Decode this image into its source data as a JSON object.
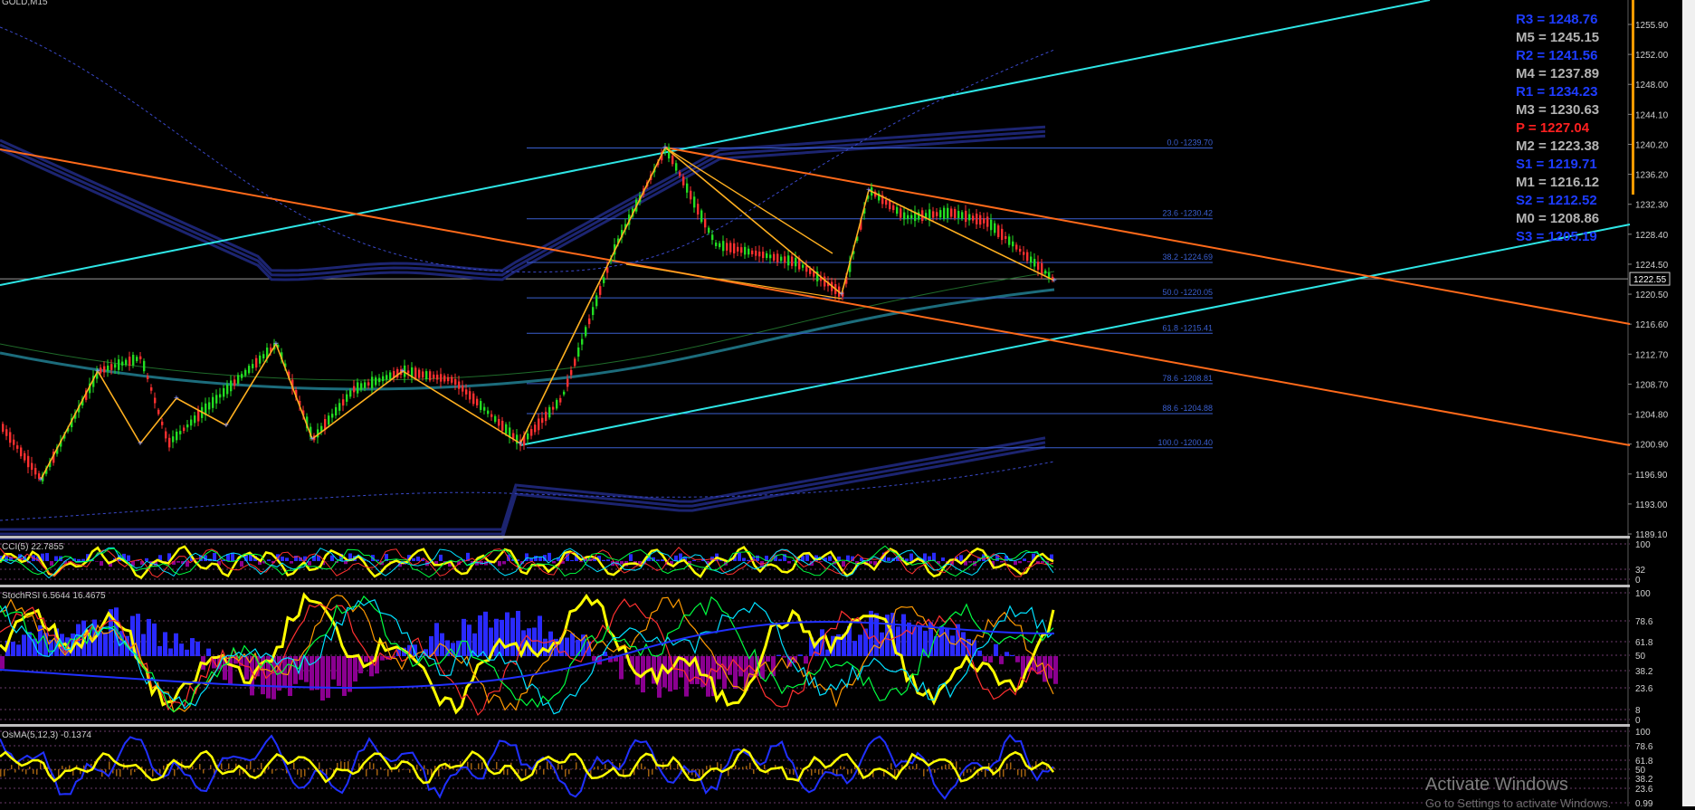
{
  "window": {
    "symbol": "GOLD,M15"
  },
  "colors": {
    "background": "#000000",
    "bull_candle": "#22dd22",
    "bear_candle": "#ff3030",
    "trend_cyan": "#2ee6e6",
    "trend_orange": "#ff6a1a",
    "fib": "#3a5fd0",
    "zigzag": "#ffb020",
    "band_navy": "#1c2470",
    "pivot_resistance": "#1e3cff",
    "pivot_mid": "#b4b4b4",
    "pivot_p": "#ff2020",
    "pivot_support": "#1e3cff"
  },
  "price_axis": {
    "labels": [
      "1255.90",
      "1252.00",
      "1248.00",
      "1244.10",
      "1240.20",
      "1236.20",
      "1232.30",
      "1228.40",
      "1224.50",
      "1220.50",
      "1216.60",
      "1212.70",
      "1208.70",
      "1204.80",
      "1200.90",
      "1196.90",
      "1193.00",
      "1189.10"
    ],
    "current_price": "1222.55"
  },
  "pivots": [
    {
      "label": "R3 = 1248.76",
      "color": "#1e3cff"
    },
    {
      "label": "M5 = 1245.15",
      "color": "#b4b4b4"
    },
    {
      "label": "R2 = 1241.56",
      "color": "#1e3cff"
    },
    {
      "label": "M4 = 1237.89",
      "color": "#b4b4b4"
    },
    {
      "label": "R1 = 1234.23",
      "color": "#1e3cff"
    },
    {
      "label": "M3 = 1230.63",
      "color": "#b4b4b4"
    },
    {
      "label": "P   = 1227.04",
      "color": "#ff2020"
    },
    {
      "label": "M2 = 1223.38",
      "color": "#b4b4b4"
    },
    {
      "label": "S1 = 1219.71",
      "color": "#1e3cff"
    },
    {
      "label": "M1 = 1216.12",
      "color": "#b4b4b4"
    },
    {
      "label": "S2 = 1212.52",
      "color": "#1e3cff"
    },
    {
      "label": "M0 = 1208.86",
      "color": "#b4b4b4"
    },
    {
      "label": "S3 = 1205.19",
      "color": "#1e3cff"
    }
  ],
  "fib_levels": [
    {
      "label": "0.0 -1239.70",
      "price": 1239.7
    },
    {
      "label": "23.6 -1230.42",
      "price": 1230.42
    },
    {
      "label": "38.2 -1224.69",
      "price": 1224.69
    },
    {
      "label": "50.0 -1220.05",
      "price": 1220.05
    },
    {
      "label": "61.8 -1215.41",
      "price": 1215.41
    },
    {
      "label": "78.6 -1208.81",
      "price": 1208.81
    },
    {
      "label": "88.6 -1204.88",
      "price": 1204.88
    },
    {
      "label": "100.0 -1200.40",
      "price": 1200.4
    }
  ],
  "sub_windows": {
    "cci": {
      "label": "CCI(5) 22.7855",
      "levels": [
        "100",
        "32",
        "0"
      ]
    },
    "stochrsi": {
      "label": "StochRSI 6.5644 16.4675",
      "levels": [
        "100",
        "78.6",
        "61.8",
        "50",
        "38.2",
        "23.6",
        "8",
        "0"
      ]
    },
    "osma": {
      "label": "OsMA(5,12,3) -0.1374",
      "levels": [
        "100",
        "78.6",
        "61.8",
        "50",
        "38.2",
        "23.6",
        "0.99"
      ]
    }
  },
  "watermark": {
    "title": "Activate Windows",
    "subtitle": "Go to Settings to activate Windows."
  }
}
